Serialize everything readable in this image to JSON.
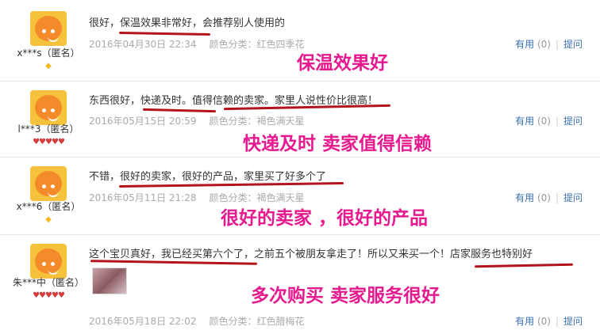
{
  "reviews": [
    {
      "username": "x***s（匿名）",
      "rank_icon": "diamond",
      "content": "很好，保温效果非常好，会推荐别人使用的",
      "date": "2016年04月30日 22:34",
      "sku": "颜色分类：红色四季花",
      "useful_label": "有用",
      "useful_count": "(0)",
      "ask_label": "提问",
      "annotation": "保温效果好"
    },
    {
      "username": "l***3（匿名）",
      "rank_icon": "hearts",
      "content": "东西很好，快递及时。值得信赖的卖家。家里人说性价比很高！",
      "date": "2016年05月15日 20:59",
      "sku": "颜色分类：褐色满天星",
      "useful_label": "有用",
      "useful_count": "(0)",
      "ask_label": "提问",
      "annotation": "快递及时 卖家值得信赖"
    },
    {
      "username": "x***6（匿名）",
      "rank_icon": "diamond",
      "content": "不错，很好的卖家，很好的产品，家里买了好多个了",
      "date": "2016年05月11日 21:28",
      "sku": "颜色分类：褐色满天星",
      "useful_label": "有用",
      "useful_count": "(0)",
      "ask_label": "提问",
      "annotation": "很好的卖家 ，很好的产品"
    },
    {
      "username": "朱***中（匿名）",
      "rank_icon": "hearts",
      "content": "这个宝贝真好，我已经买第六个了，之前五个被朋友拿走了！所以又来买一个！店家服务也特别好",
      "date": "2016年05月18日 22:02",
      "sku": "颜色分类：红色腊梅花",
      "useful_label": "有用",
      "useful_count": "(0)",
      "ask_label": "提问",
      "annotation": "多次购买 卖家服务很好"
    }
  ],
  "colors": {
    "annotation": "#e6198e",
    "underline": "#b3131d",
    "link": "#3a6fb0",
    "meta": "#aaaaaa"
  }
}
